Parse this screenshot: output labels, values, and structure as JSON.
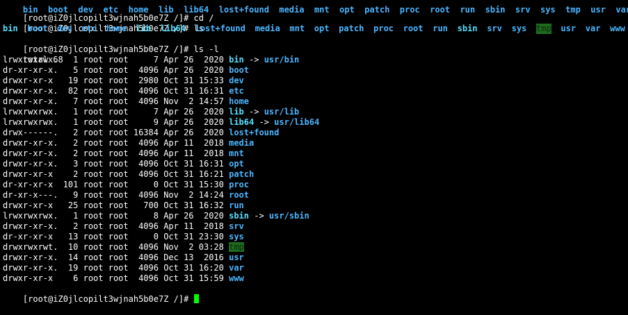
{
  "partial_line": "bin  boot  dev  etc  home  lib  lib64  lost+found  media  mnt  opt  patch  proc  root  run  sbin  srv  sys  tmp  usr  var  www",
  "prompt": "[root@iZ0jlcopilt3wjnah5b0e7Z /]# ",
  "cmd_cd": "cd /",
  "cmd_ls": "ls",
  "ls_items": [
    {
      "name": "bin",
      "type": "link"
    },
    {
      "name": "boot",
      "type": "dir"
    },
    {
      "name": "dev",
      "type": "dir"
    },
    {
      "name": "etc",
      "type": "dir"
    },
    {
      "name": "home",
      "type": "dir"
    },
    {
      "name": "lib",
      "type": "link"
    },
    {
      "name": "lib64",
      "type": "link"
    },
    {
      "name": "lost+found",
      "type": "dir"
    },
    {
      "name": "media",
      "type": "dir"
    },
    {
      "name": "mnt",
      "type": "dir"
    },
    {
      "name": "opt",
      "type": "dir"
    },
    {
      "name": "patch",
      "type": "dir"
    },
    {
      "name": "proc",
      "type": "dir"
    },
    {
      "name": "root",
      "type": "dir"
    },
    {
      "name": "run",
      "type": "dir"
    },
    {
      "name": "sbin",
      "type": "link"
    },
    {
      "name": "srv",
      "type": "dir"
    },
    {
      "name": "sys",
      "type": "dir"
    },
    {
      "name": "tmp",
      "type": "tmp"
    },
    {
      "name": "usr",
      "type": "dir"
    },
    {
      "name": "var",
      "type": "dir"
    },
    {
      "name": "www",
      "type": "dir"
    }
  ],
  "cmd_lsl": "ls -l",
  "total": "total 68",
  "entries": [
    {
      "meta": "lrwxrwxrwx.   1 root root     7 Apr 26  2020 ",
      "name": "bin",
      "type": "link",
      "arrow": " -> ",
      "target": "usr/bin"
    },
    {
      "meta": "dr-xr-xr-x.   5 root root  4096 Apr 26  2020 ",
      "name": "boot",
      "type": "dir",
      "arrow": "",
      "target": ""
    },
    {
      "meta": "drwxr-xr-x   19 root root  2980 Oct 31 15:33 ",
      "name": "dev",
      "type": "dir",
      "arrow": "",
      "target": ""
    },
    {
      "meta": "drwxr-xr-x.  82 root root  4096 Oct 31 16:31 ",
      "name": "etc",
      "type": "dir",
      "arrow": "",
      "target": ""
    },
    {
      "meta": "drwxr-xr-x.   7 root root  4096 Nov  2 14:57 ",
      "name": "home",
      "type": "dir",
      "arrow": "",
      "target": ""
    },
    {
      "meta": "lrwxrwxrwx.   1 root root     7 Apr 26  2020 ",
      "name": "lib",
      "type": "link",
      "arrow": " -> ",
      "target": "usr/lib"
    },
    {
      "meta": "lrwxrwxrwx.   1 root root     9 Apr 26  2020 ",
      "name": "lib64",
      "type": "link",
      "arrow": " -> ",
      "target": "usr/lib64"
    },
    {
      "meta": "drwx------.   2 root root 16384 Apr 26  2020 ",
      "name": "lost+found",
      "type": "dir",
      "arrow": "",
      "target": ""
    },
    {
      "meta": "drwxr-xr-x.   2 root root  4096 Apr 11  2018 ",
      "name": "media",
      "type": "dir",
      "arrow": "",
      "target": ""
    },
    {
      "meta": "drwxr-xr-x.   2 root root  4096 Apr 11  2018 ",
      "name": "mnt",
      "type": "dir",
      "arrow": "",
      "target": ""
    },
    {
      "meta": "drwxr-xr-x.   3 root root  4096 Oct 31 16:31 ",
      "name": "opt",
      "type": "dir",
      "arrow": "",
      "target": ""
    },
    {
      "meta": "drwxr-xr-x    2 root root  4096 Oct 31 16:21 ",
      "name": "patch",
      "type": "dir",
      "arrow": "",
      "target": ""
    },
    {
      "meta": "dr-xr-xr-x  101 root root     0 Oct 31 15:30 ",
      "name": "proc",
      "type": "dir",
      "arrow": "",
      "target": ""
    },
    {
      "meta": "dr-xr-x---.   9 root root  4096 Nov  2 14:24 ",
      "name": "root",
      "type": "dir",
      "arrow": "",
      "target": ""
    },
    {
      "meta": "drwxr-xr-x   25 root root   700 Oct 31 16:32 ",
      "name": "run",
      "type": "dir",
      "arrow": "",
      "target": ""
    },
    {
      "meta": "lrwxrwxrwx.   1 root root     8 Apr 26  2020 ",
      "name": "sbin",
      "type": "link",
      "arrow": " -> ",
      "target": "usr/sbin"
    },
    {
      "meta": "drwxr-xr-x.   2 root root  4096 Apr 11  2018 ",
      "name": "srv",
      "type": "dir",
      "arrow": "",
      "target": ""
    },
    {
      "meta": "dr-xr-xr-x   13 root root     0 Oct 31 23:30 ",
      "name": "sys",
      "type": "dir",
      "arrow": "",
      "target": ""
    },
    {
      "meta": "drwxrwxrwt.  10 root root  4096 Nov  2 03:28 ",
      "name": "tmp",
      "type": "tmp",
      "arrow": "",
      "target": ""
    },
    {
      "meta": "drwxr-xr-x.  14 root root  4096 Dec 13  2016 ",
      "name": "usr",
      "type": "dir",
      "arrow": "",
      "target": ""
    },
    {
      "meta": "drwxr-xr-x.  19 root root  4096 Oct 31 16:20 ",
      "name": "var",
      "type": "dir",
      "arrow": "",
      "target": ""
    },
    {
      "meta": "drwxr-xr-x    6 root root  4096 Oct 31 15:59 ",
      "name": "www",
      "type": "dir",
      "arrow": "",
      "target": ""
    }
  ],
  "colors": {
    "background": "#000000",
    "text": "#ffffff",
    "dir": "#4bb6ff",
    "link": "#55e0ff",
    "tmp_bg": "#1f6b1f",
    "cursor": "#00ff00"
  }
}
